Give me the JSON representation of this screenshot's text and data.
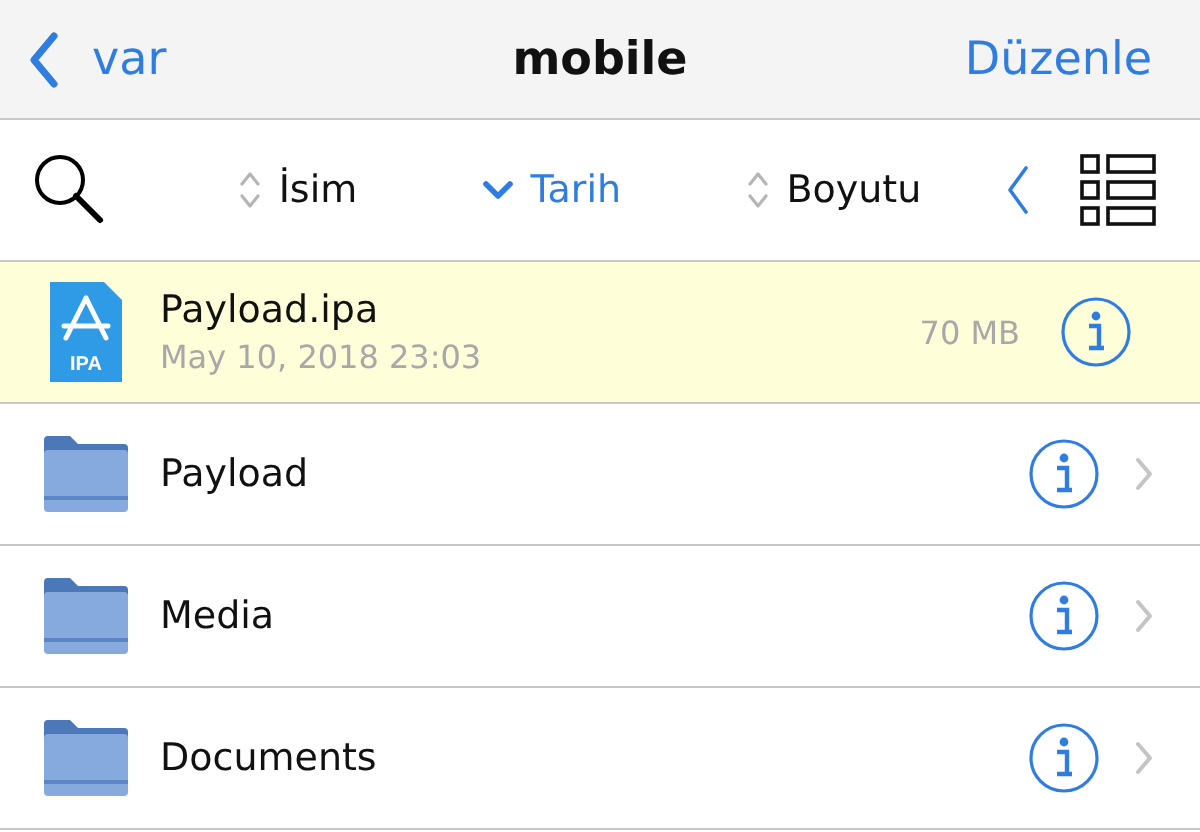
{
  "nav": {
    "back": "var",
    "title": "mobile",
    "action": "Düzenle"
  },
  "sort_options": [
    {
      "label": "İsim",
      "selected": false
    },
    {
      "label": "Tarih",
      "selected": true
    },
    {
      "label": "Boyutu",
      "selected": false
    }
  ],
  "files": [
    {
      "kind": "ipa",
      "name": "Payload.ipa",
      "date": "May 10, 2018 23:03",
      "size": "70 MB",
      "selected": true,
      "icon_label": "IPA"
    },
    {
      "kind": "folder",
      "name": "Payload",
      "selected": false
    },
    {
      "kind": "folder",
      "name": "Media",
      "selected": false
    },
    {
      "kind": "folder",
      "name": "Documents",
      "selected": false
    }
  ]
}
